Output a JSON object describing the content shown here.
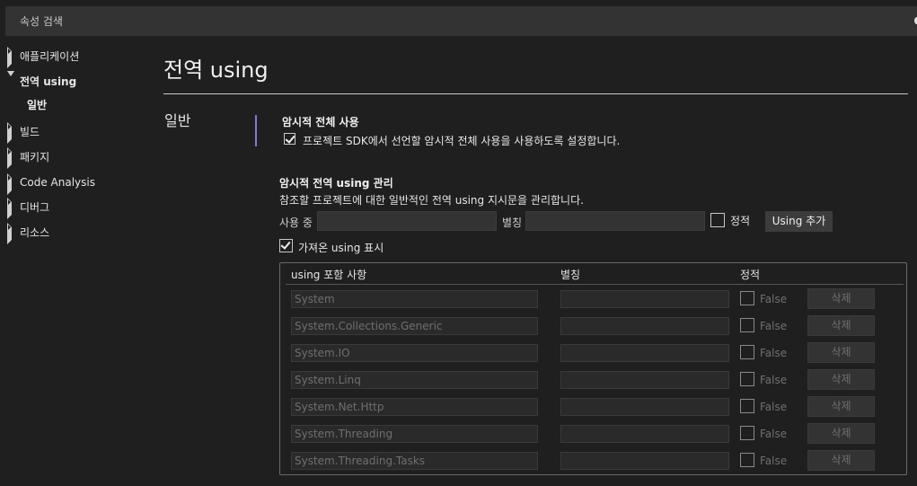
{
  "search": {
    "placeholder": "속성 검색"
  },
  "sidebar": {
    "items": [
      {
        "label": "애플리케이션",
        "expanded": false
      },
      {
        "label": "전역 using",
        "expanded": true,
        "children": [
          "일반"
        ]
      },
      {
        "label": "빌드",
        "expanded": false
      },
      {
        "label": "패키지",
        "expanded": false
      },
      {
        "label": "Code Analysis",
        "expanded": false
      },
      {
        "label": "디버그",
        "expanded": false
      },
      {
        "label": "리소스",
        "expanded": false
      }
    ]
  },
  "page": {
    "title": "전역 using",
    "section": "일반"
  },
  "implicit": {
    "heading": "암시적 전체 사용",
    "checkbox_label": "프로젝트 SDK에서 선언할 암시적 전체 사용을 사용하도록 설정합니다.",
    "checked": true
  },
  "manage": {
    "heading": "암시적 전역 using 관리",
    "description": "참조할 프로젝트에 대한 일반적인 전역 using 지시문을 관리합니다.",
    "using_label": "사용 중",
    "using_value": "",
    "alias_label": "별칭",
    "alias_value": "",
    "static_label": "정적",
    "static_checked": false,
    "add_button": "Using 추가",
    "show_imported_label": "가져온 using 표시",
    "show_imported_checked": true
  },
  "grid": {
    "columns": [
      "using 포함 사항",
      "별칭",
      "정적"
    ],
    "rows": [
      {
        "using": "System",
        "alias": "",
        "static": "False",
        "delete": "삭제"
      },
      {
        "using": "System.Collections.Generic",
        "alias": "",
        "static": "False",
        "delete": "삭제"
      },
      {
        "using": "System.IO",
        "alias": "",
        "static": "False",
        "delete": "삭제"
      },
      {
        "using": "System.Linq",
        "alias": "",
        "static": "False",
        "delete": "삭제"
      },
      {
        "using": "System.Net.Http",
        "alias": "",
        "static": "False",
        "delete": "삭제"
      },
      {
        "using": "System.Threading",
        "alias": "",
        "static": "False",
        "delete": "삭제"
      },
      {
        "using": "System.Threading.Tasks",
        "alias": "",
        "static": "False",
        "delete": "삭제"
      }
    ]
  },
  "colors": {
    "accent": "#8a74d8",
    "background": "#1f1f1f",
    "surface": "#333333"
  }
}
